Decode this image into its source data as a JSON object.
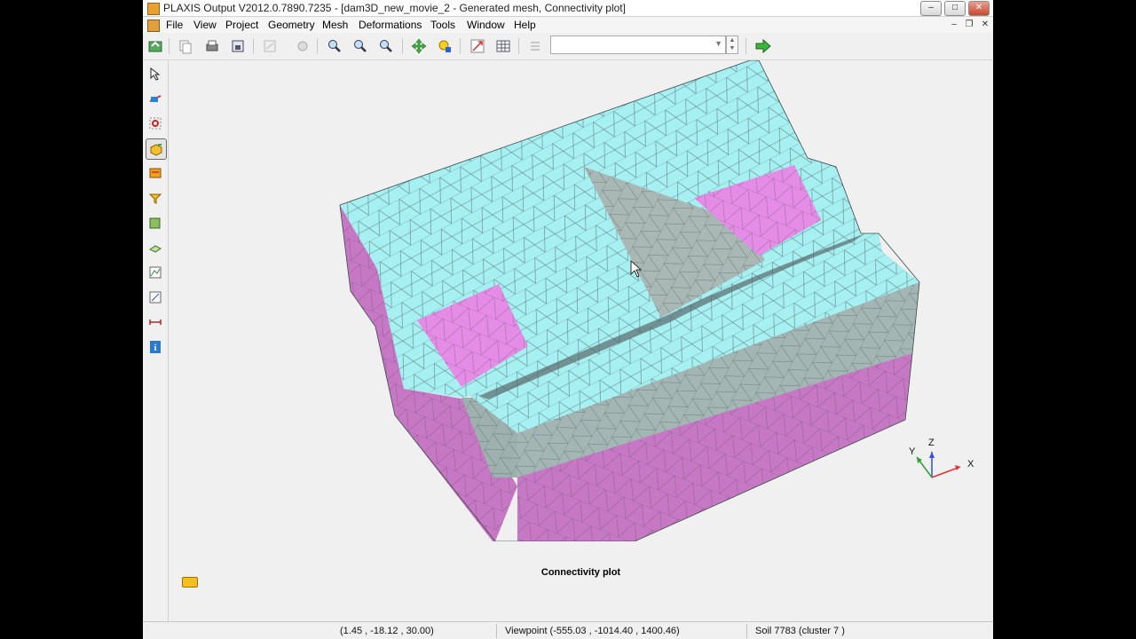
{
  "window": {
    "title": "PLAXIS Output V2012.0.7890.7235 - [dam3D_new_movie_2 - Generated mesh, Connectivity plot]",
    "controls": {
      "minimize": "‒",
      "maximize": "□",
      "close": "✕"
    }
  },
  "menu": {
    "items": [
      "File",
      "View",
      "Project",
      "Geometry",
      "Mesh",
      "Deformations",
      "Tools",
      "Window",
      "Help"
    ],
    "controls": {
      "minimize": "‒",
      "restore": "❐",
      "close": "✕"
    }
  },
  "toolbar": {
    "icons": [
      "open-icon",
      "copy-icon",
      "print-icon",
      "export-icon",
      "zoom-window-icon",
      "rotate-icon",
      "zoom-in-icon",
      "zoom-out-icon",
      "zoom-fit-icon",
      "move-icon",
      "light-icon",
      "drawing-scale-icon",
      "table-icon",
      "list-icon",
      "step-forward-icon"
    ],
    "step_combo_value": ""
  },
  "sidebar": {
    "tools": [
      "select-icon",
      "cross-section-icon",
      "point-select-icon",
      "hide-soil-icon",
      "hide-structure-icon",
      "filter-icon",
      "select-points-icon",
      "curve-points-icon",
      "curves-icon",
      "curves-manager-icon",
      "distance-icon",
      "info-icon"
    ],
    "active_index": 3
  },
  "axes": {
    "x": "X",
    "y": "Y",
    "z": "Z"
  },
  "caption": "Connectivity plot",
  "status": {
    "cursor_coords": "(1.45 , -18.12 , 30.00)",
    "viewpoint": "Viewpoint (-555.03 , -1014.40 , 1400.46)",
    "selection": "Soil 7783 (cluster 7 )"
  },
  "colors": {
    "mesh_top": "#a6f0f2",
    "soil_pink": "#e58ce6",
    "side_gray": "#9fb1af",
    "side_magenta": "#c877c5",
    "mesh_line": "#4a5a5c",
    "axis_x": "#e83030",
    "axis_y": "#30a030",
    "axis_z": "#3050e0"
  }
}
